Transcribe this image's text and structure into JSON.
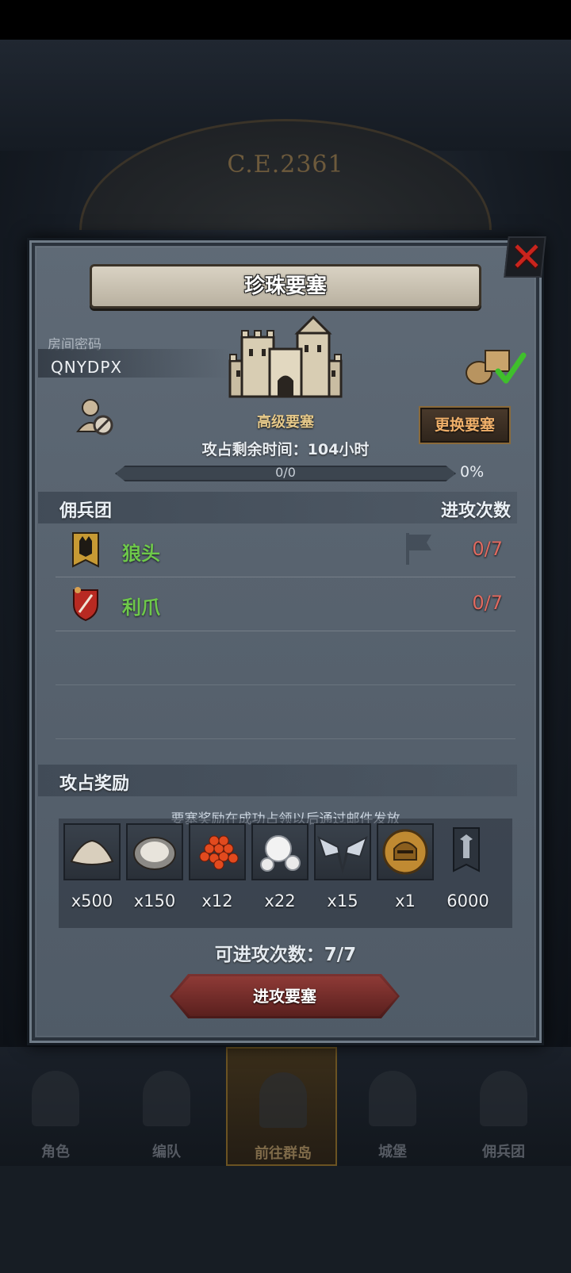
{
  "background": {
    "dial_text": "C.E.2361",
    "bottom_nav": [
      {
        "label": "角色",
        "active": false
      },
      {
        "label": "编队",
        "active": false
      },
      {
        "label": "前往群岛",
        "active": true
      },
      {
        "label": "城堡",
        "active": false
      },
      {
        "label": "佣兵团",
        "active": false
      }
    ]
  },
  "dialog": {
    "title": "珍珠要塞",
    "close_icon": "close-x-icon",
    "room_label": "房间密码",
    "room_code": "QNYDPX",
    "fortress_type": "高级要塞",
    "swap_button": "更换要塞",
    "time_remaining": "攻占剩余时间：104小时",
    "progress": {
      "label": "0/0",
      "percent": "0%",
      "value": 0
    },
    "colors": {
      "accent": "#e6c98a",
      "merc_name": "#6ec84a",
      "count": "#e06a60",
      "attack_button": "#7a3230"
    }
  },
  "mercenaries": {
    "header_left": "佣兵团",
    "header_right": "进攻次数",
    "rows": [
      {
        "name": "狼头",
        "count": "0/7",
        "emblem": "wolf-banner-icon"
      },
      {
        "name": "利爪",
        "count": "0/7",
        "emblem": "claw-shield-icon"
      }
    ]
  },
  "rewards": {
    "header": "攻占奖励",
    "note": "要塞奖励在成功占领以后通过邮件发放",
    "items": [
      {
        "icon": "sand-icon",
        "qty": "x500"
      },
      {
        "icon": "oyster-icon",
        "qty": "x150"
      },
      {
        "icon": "caviar-icon",
        "qty": "x12"
      },
      {
        "icon": "pearl-icon",
        "qty": "x22"
      },
      {
        "icon": "wings-emblem-icon",
        "qty": "x15"
      },
      {
        "icon": "helmet-coin-icon",
        "qty": "x1"
      },
      {
        "icon": "guild-banner-icon",
        "qty": "6000"
      }
    ]
  },
  "footer": {
    "attacks_available": "可进攻次数：7/7",
    "attack_button": "进攻要塞"
  }
}
